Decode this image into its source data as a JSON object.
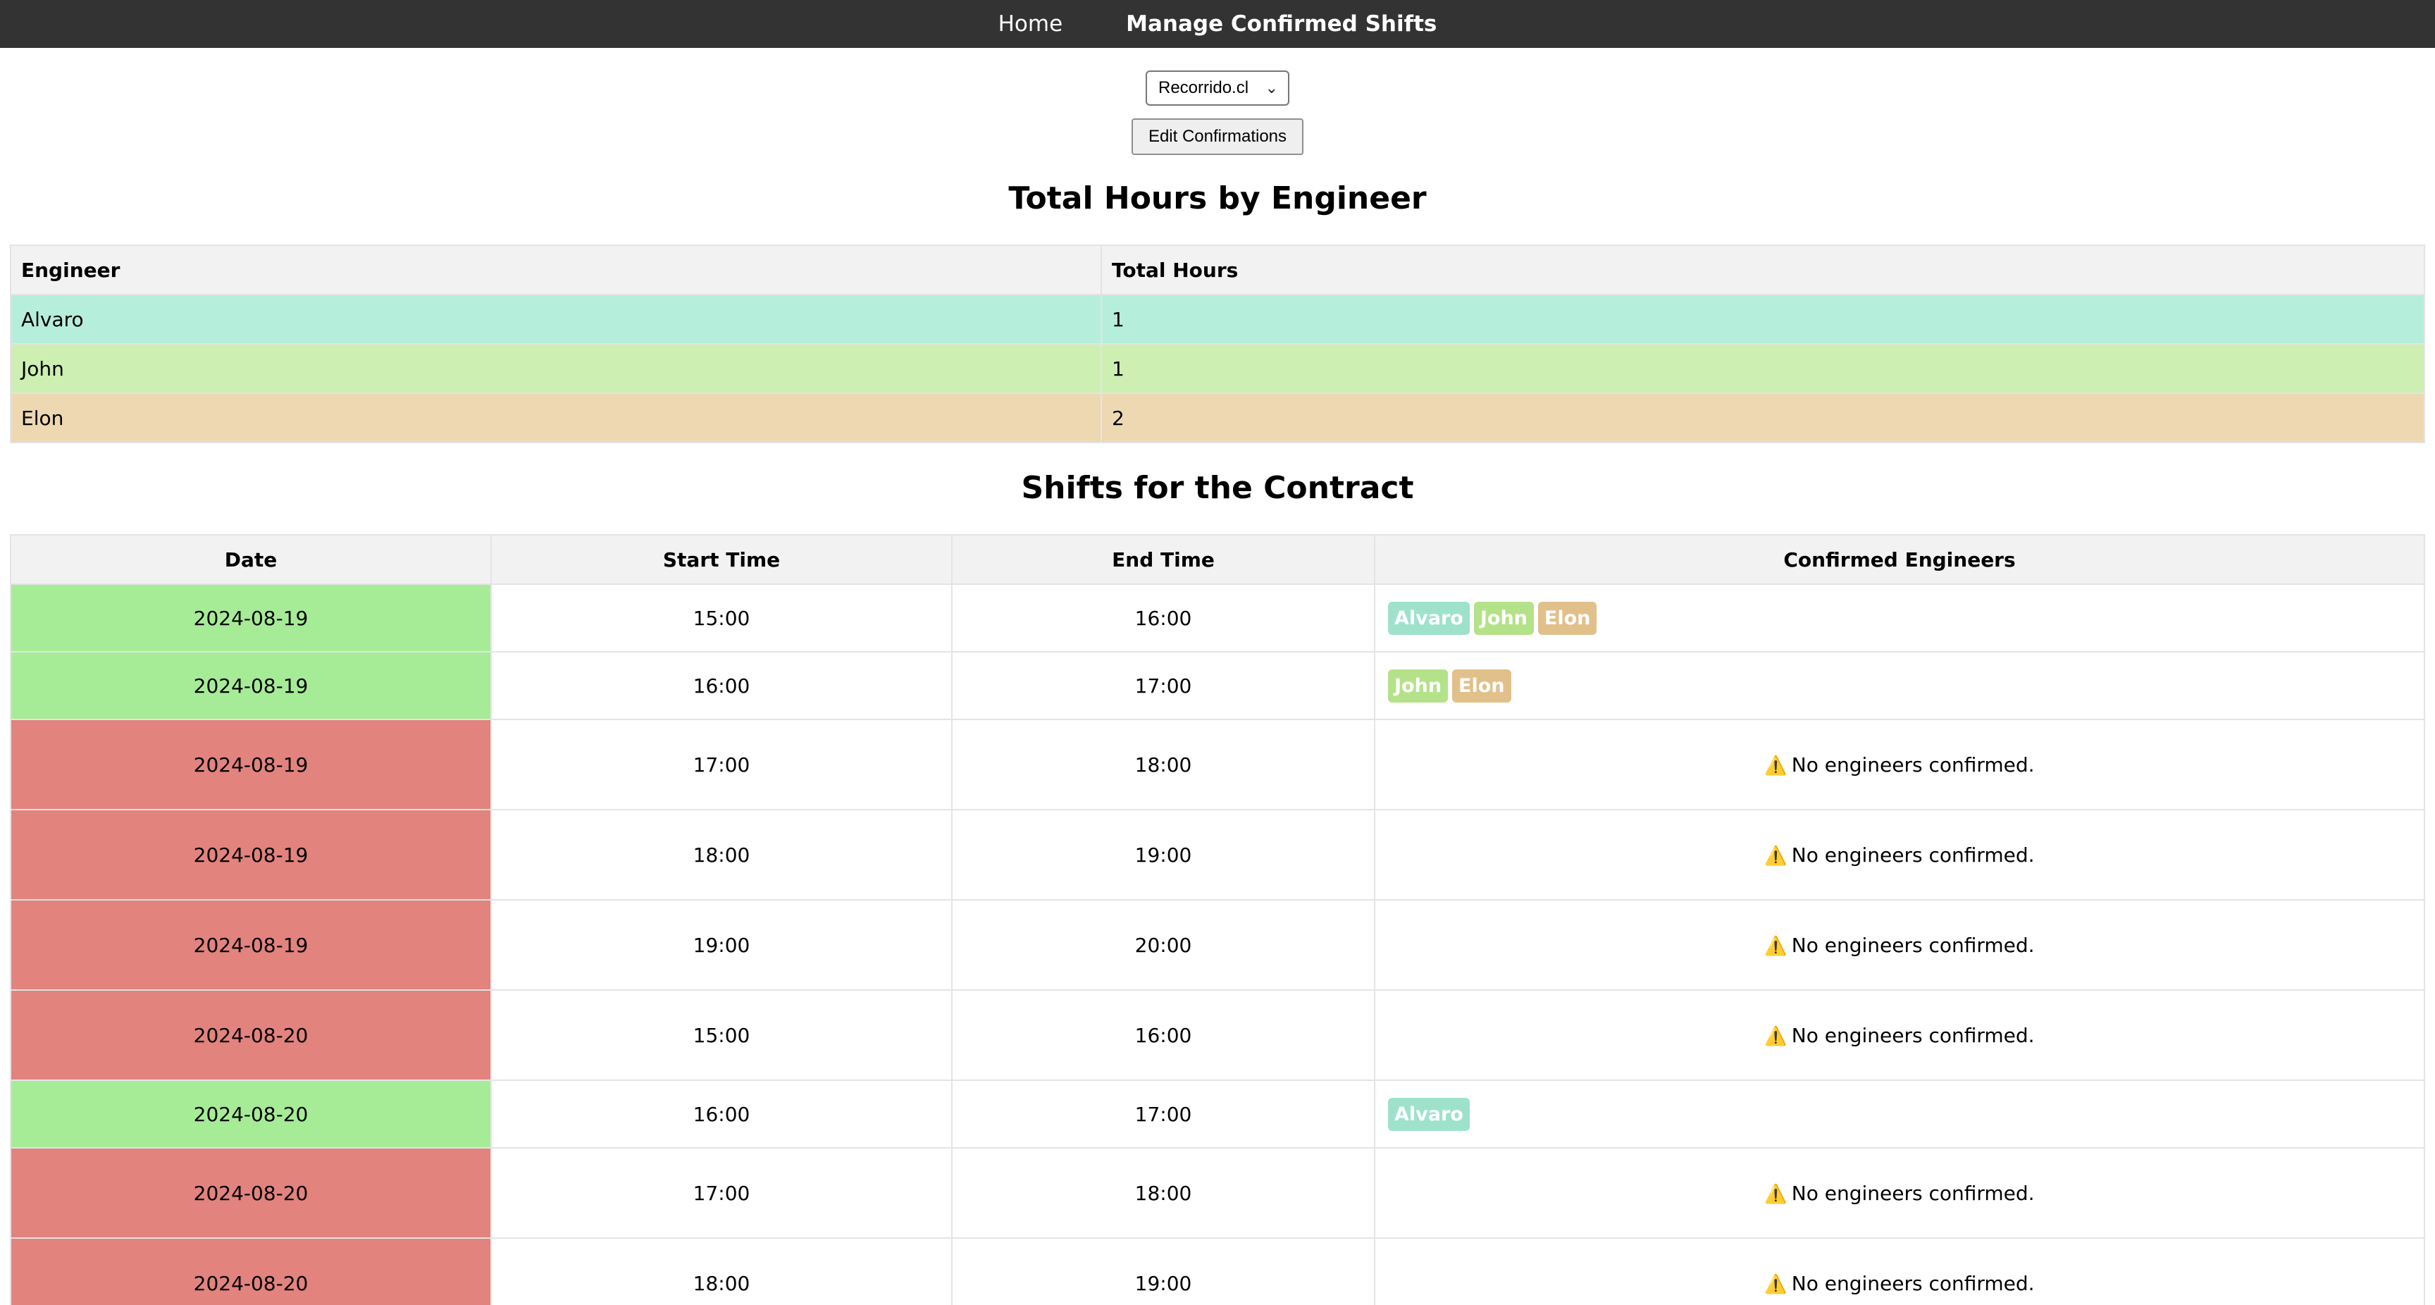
{
  "nav": {
    "home": "Home",
    "manage": "Manage Confirmed Shifts"
  },
  "contract_select": {
    "selected": "Recorrido.cl"
  },
  "edit_button": "Edit Confirmations",
  "hours": {
    "title": "Total Hours by Engineer",
    "headers": [
      "Engineer",
      "Total Hours"
    ],
    "rows": [
      {
        "engineer": "Alvaro",
        "hours": "1",
        "color": "#b6eedc"
      },
      {
        "engineer": "John",
        "hours": "1",
        "color": "#cdefb1"
      },
      {
        "engineer": "Elon",
        "hours": "2",
        "color": "#edd8b1"
      }
    ]
  },
  "engineer_badge_colors": {
    "Alvaro": "#9ee2cc",
    "John": "#b4e288",
    "Elon": "#e2c08a"
  },
  "status_colors": {
    "confirmed": "#a6ec97",
    "unconfirmed": "#e2837e"
  },
  "shifts": {
    "title": "Shifts for the Contract",
    "headers": [
      "Date",
      "Start Time",
      "End Time",
      "Confirmed Engineers"
    ],
    "empty_text": "No engineers confirmed.",
    "warning_icon": "warning-icon",
    "rows": [
      {
        "date": "2024-08-19",
        "start": "15:00",
        "end": "16:00",
        "engineers": [
          "Alvaro",
          "John",
          "Elon"
        ]
      },
      {
        "date": "2024-08-19",
        "start": "16:00",
        "end": "17:00",
        "engineers": [
          "John",
          "Elon"
        ]
      },
      {
        "date": "2024-08-19",
        "start": "17:00",
        "end": "18:00",
        "engineers": []
      },
      {
        "date": "2024-08-19",
        "start": "18:00",
        "end": "19:00",
        "engineers": []
      },
      {
        "date": "2024-08-19",
        "start": "19:00",
        "end": "20:00",
        "engineers": []
      },
      {
        "date": "2024-08-20",
        "start": "15:00",
        "end": "16:00",
        "engineers": []
      },
      {
        "date": "2024-08-20",
        "start": "16:00",
        "end": "17:00",
        "engineers": [
          "Alvaro"
        ]
      },
      {
        "date": "2024-08-20",
        "start": "17:00",
        "end": "18:00",
        "engineers": []
      },
      {
        "date": "2024-08-20",
        "start": "18:00",
        "end": "19:00",
        "engineers": []
      }
    ]
  }
}
